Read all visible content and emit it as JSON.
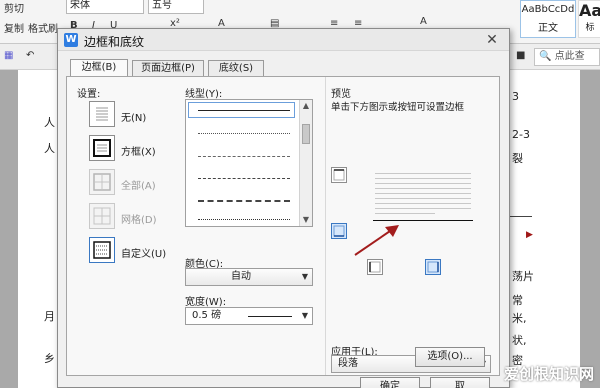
{
  "ribbon": {
    "cut": "剪切",
    "copy": "复制",
    "format_painter": "格式刷",
    "font_name": "宋体",
    "font_size": "五号",
    "style1_preview": "AaBbCcDd",
    "style1_name": "正文",
    "style2_preview": "Aa",
    "style2_name": "标",
    "search": "点此查"
  },
  "dialog": {
    "title": "边框和底纹",
    "tabs": [
      "边框(B)",
      "页面边框(P)",
      "底纹(S)"
    ],
    "settings_label": "设置:",
    "settings": [
      {
        "label": "无(N)",
        "enabled": true
      },
      {
        "label": "方框(X)",
        "enabled": true
      },
      {
        "label": "全部(A)",
        "enabled": false
      },
      {
        "label": "网格(D)",
        "enabled": false
      },
      {
        "label": "自定义(U)",
        "enabled": true
      }
    ],
    "line_type_label": "线型(Y):",
    "color_label": "颜色(C):",
    "color_value": "自动",
    "width_label": "宽度(W):",
    "width_value": "0.5  磅",
    "preview_label": "预览",
    "preview_hint": "单击下方图示或按钮可设置边框",
    "apply_to_label": "应用于(L):",
    "apply_to_value": "段落",
    "options_button": "选项(O)...",
    "ok_button": "确定",
    "cancel_button": "取"
  },
  "document_side_text": [
    "3",
    "2-3",
    "裂",
    "荡片",
    "常",
    "米,",
    "状,",
    "密"
  ],
  "document_left_marks": [
    "人",
    "人",
    "月",
    "乡"
  ],
  "watermark": "爱创根知识网"
}
